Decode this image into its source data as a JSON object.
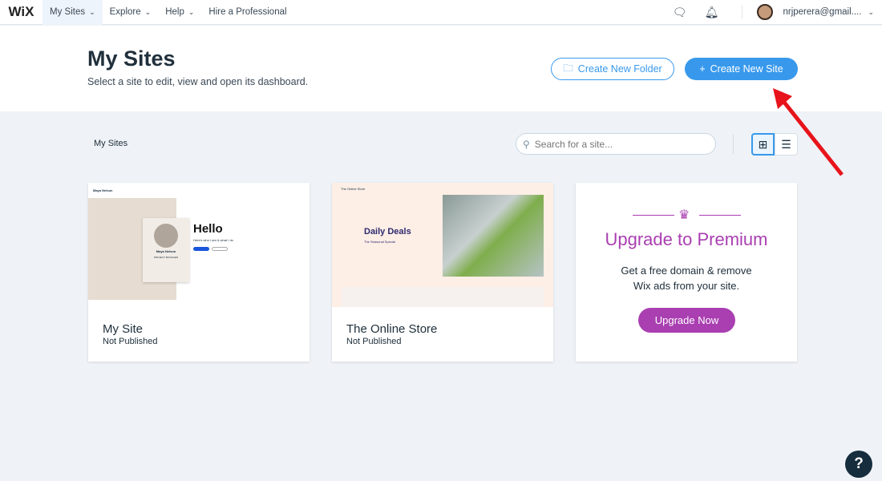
{
  "topbar": {
    "logo": "WiX",
    "nav": [
      {
        "label": "My Sites",
        "chevron": true
      },
      {
        "label": "Explore",
        "chevron": true
      },
      {
        "label": "Help",
        "chevron": true
      },
      {
        "label": "Hire a Professional",
        "chevron": false
      }
    ],
    "user": "nrjperera@gmail...."
  },
  "header": {
    "title": "My Sites",
    "subtitle": "Select a site to edit, view and open its dashboard.",
    "create_folder": "Create New Folder",
    "create_site": "Create New Site"
  },
  "toolbar": {
    "breadcrumb": "My Sites",
    "search_placeholder": "Search for a site..."
  },
  "sites": [
    {
      "name": "My Site",
      "status": "Not Published",
      "preview": {
        "brand": "Maya Nelson",
        "role": "PROJECT MANAGER",
        "hello": "Hello",
        "tagline": "Here's who I am & what I do",
        "person": "Maya Nelson"
      }
    },
    {
      "name": "The Online Store",
      "status": "Not Published",
      "preview": {
        "brand": "The Online Store",
        "headline": "Daily Deals",
        "tagline": "The Seasonal Special"
      }
    }
  ],
  "premium": {
    "title": "Upgrade to Premium",
    "text1": "Get a free domain & remove",
    "text2": "Wix ads from your site.",
    "button": "Upgrade Now",
    "accent": "#a93fb1"
  },
  "colors": {
    "primary": "#3899ec",
    "premium": "#a93fb1"
  },
  "help": "?"
}
